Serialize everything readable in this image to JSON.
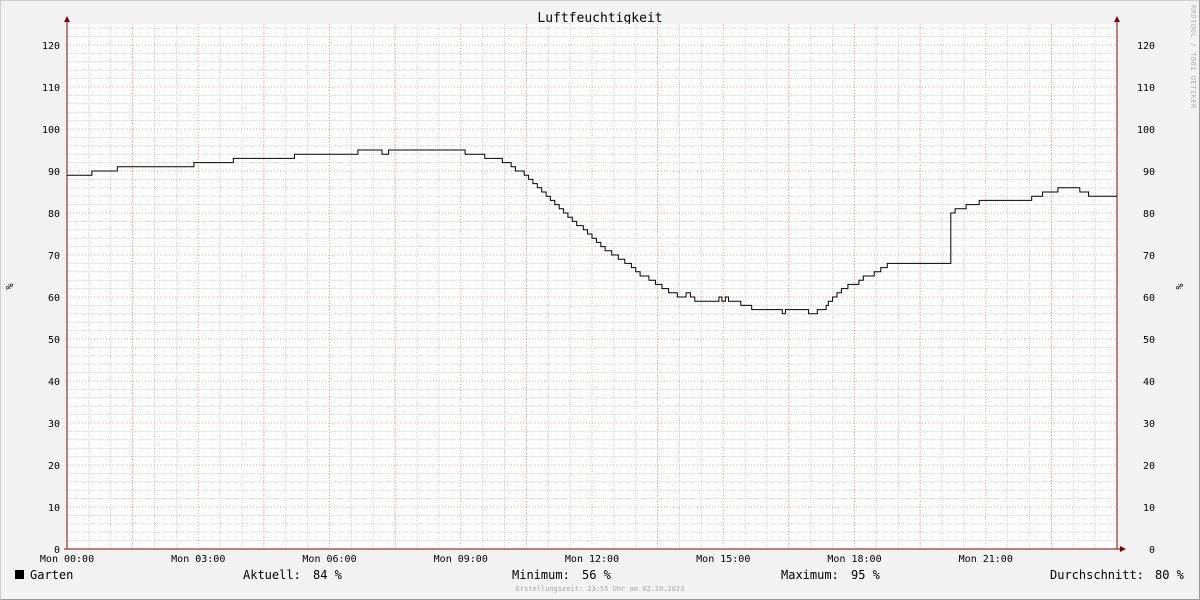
{
  "chart_data": {
    "type": "line",
    "title": "Luftfeuchtigkeit",
    "ylabel": "%",
    "ylim": [
      0,
      125
    ],
    "yticks": [
      0,
      10,
      20,
      30,
      40,
      50,
      60,
      70,
      80,
      90,
      100,
      110,
      120
    ],
    "xlim_hours": [
      0,
      24
    ],
    "xticks": [
      {
        "hour": 0,
        "label": "Mon 00:00"
      },
      {
        "hour": 3,
        "label": "Mon 03:00"
      },
      {
        "hour": 6,
        "label": "Mon 06:00"
      },
      {
        "hour": 9,
        "label": "Mon 09:00"
      },
      {
        "hour": 12,
        "label": "Mon 12:00"
      },
      {
        "hour": 15,
        "label": "Mon 15:00"
      },
      {
        "hour": 18,
        "label": "Mon 18:00"
      },
      {
        "hour": 21,
        "label": "Mon 21:00"
      }
    ],
    "grid": true,
    "series": [
      {
        "name": "Garten",
        "color": "#000000",
        "points": [
          [
            0.0,
            89
          ],
          [
            0.57,
            90
          ],
          [
            1.15,
            91
          ],
          [
            2.9,
            92
          ],
          [
            3.8,
            93
          ],
          [
            5.2,
            94
          ],
          [
            6.65,
            95
          ],
          [
            7.2,
            94
          ],
          [
            7.35,
            95
          ],
          [
            9.1,
            94
          ],
          [
            9.55,
            93
          ],
          [
            9.95,
            92
          ],
          [
            10.15,
            91
          ],
          [
            10.25,
            90
          ],
          [
            10.45,
            89
          ],
          [
            10.55,
            88
          ],
          [
            10.65,
            87
          ],
          [
            10.75,
            86
          ],
          [
            10.85,
            85
          ],
          [
            10.95,
            84
          ],
          [
            11.05,
            83
          ],
          [
            11.15,
            82
          ],
          [
            11.25,
            81
          ],
          [
            11.35,
            80
          ],
          [
            11.45,
            79
          ],
          [
            11.55,
            78
          ],
          [
            11.65,
            77
          ],
          [
            11.8,
            76
          ],
          [
            11.9,
            75
          ],
          [
            12.0,
            74
          ],
          [
            12.1,
            73
          ],
          [
            12.2,
            72
          ],
          [
            12.3,
            71
          ],
          [
            12.45,
            70
          ],
          [
            12.6,
            69
          ],
          [
            12.75,
            68
          ],
          [
            12.9,
            67
          ],
          [
            13.0,
            66
          ],
          [
            13.1,
            65
          ],
          [
            13.3,
            64
          ],
          [
            13.45,
            63
          ],
          [
            13.6,
            62
          ],
          [
            13.75,
            61
          ],
          [
            13.95,
            60
          ],
          [
            14.15,
            61
          ],
          [
            14.25,
            60
          ],
          [
            14.35,
            59
          ],
          [
            14.9,
            60
          ],
          [
            14.97,
            59
          ],
          [
            15.05,
            60
          ],
          [
            15.12,
            59
          ],
          [
            15.4,
            58
          ],
          [
            15.65,
            57
          ],
          [
            16.35,
            56
          ],
          [
            16.42,
            57
          ],
          [
            16.95,
            56
          ],
          [
            17.15,
            57
          ],
          [
            17.35,
            58
          ],
          [
            17.4,
            59
          ],
          [
            17.5,
            60
          ],
          [
            17.6,
            61
          ],
          [
            17.7,
            62
          ],
          [
            17.85,
            63
          ],
          [
            18.1,
            64
          ],
          [
            18.2,
            65
          ],
          [
            18.45,
            66
          ],
          [
            18.6,
            67
          ],
          [
            18.75,
            68
          ],
          [
            20.2,
            80
          ],
          [
            20.3,
            81
          ],
          [
            20.55,
            82
          ],
          [
            20.85,
            83
          ],
          [
            22.05,
            84
          ],
          [
            22.3,
            85
          ],
          [
            22.65,
            86
          ],
          [
            23.15,
            85
          ],
          [
            23.35,
            84
          ],
          [
            24.0,
            84
          ]
        ]
      }
    ]
  },
  "legend": {
    "series_name": "Garten",
    "current_label": "Aktuell:",
    "current_value": "84 %",
    "min_label": "Minimum:",
    "min_value": "56 %",
    "max_label": "Maximum:",
    "max_value": "95 %",
    "avg_label": "Durchschnitt:",
    "avg_value": "80 %"
  },
  "footer": "Erstellungszeit: 23:55 Uhr am 02.10.2023",
  "watermark": "RRDTOOL / TOBI OETIKER",
  "colors": {
    "background": "#f3f3f3",
    "plot_area": "#ffffff",
    "minor_grid": "#d4d4d4",
    "major_grid": "#e8a0a0",
    "axis": "#8b0000",
    "line": "#000000"
  }
}
